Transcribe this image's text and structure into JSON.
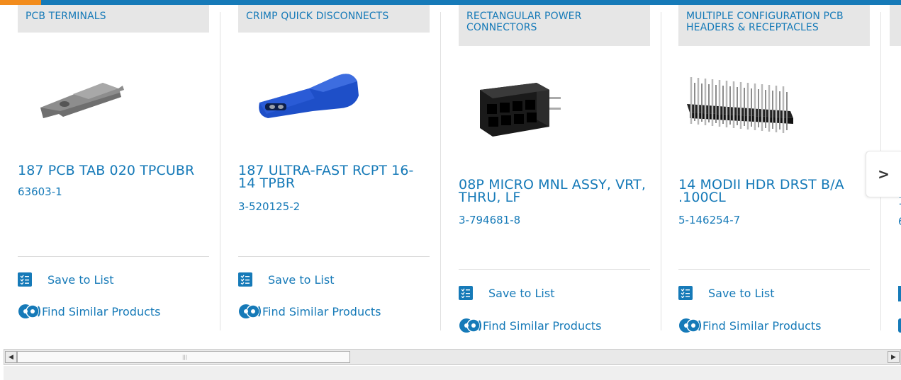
{
  "products": [
    {
      "category": "PCB TERMINALS",
      "name": "187 PCB TAB 020 TPCUBR",
      "part_number": "63603-1",
      "save_label": "Save to List",
      "similar_label": "Find Similar Products"
    },
    {
      "category": "CRIMP QUICK DISCONNECTS",
      "name": "187 ULTRA-FAST RCPT 16-14 TPBR",
      "part_number": "3-520125-2",
      "save_label": "Save to List",
      "similar_label": "Find Similar Products"
    },
    {
      "category": "RECTANGULAR POWER CONNECTORS",
      "name": "08P MICRO MNL ASSY, VRT, THRU, LF",
      "part_number": "3-794681-8",
      "save_label": "Save to List",
      "similar_label": "Find Similar Products"
    },
    {
      "category": "MULTIPLE CONFIGURATION PCB HEADERS & RECEPTACLES",
      "name": "14 MODII HDR DRST B/A .100CL",
      "part_number": "5-146254-7",
      "save_label": "Save to List",
      "similar_label": "Find Similar Products"
    }
  ],
  "next_button": {
    "icon": "chevron-right-icon",
    "glyph": ">"
  },
  "partial_card": {
    "name_fragment": "1",
    "part_fragment": "6"
  },
  "colors": {
    "brand_blue": "#167ab8",
    "accent_orange": "#f28c1d",
    "category_bg": "#e6e6e6"
  }
}
